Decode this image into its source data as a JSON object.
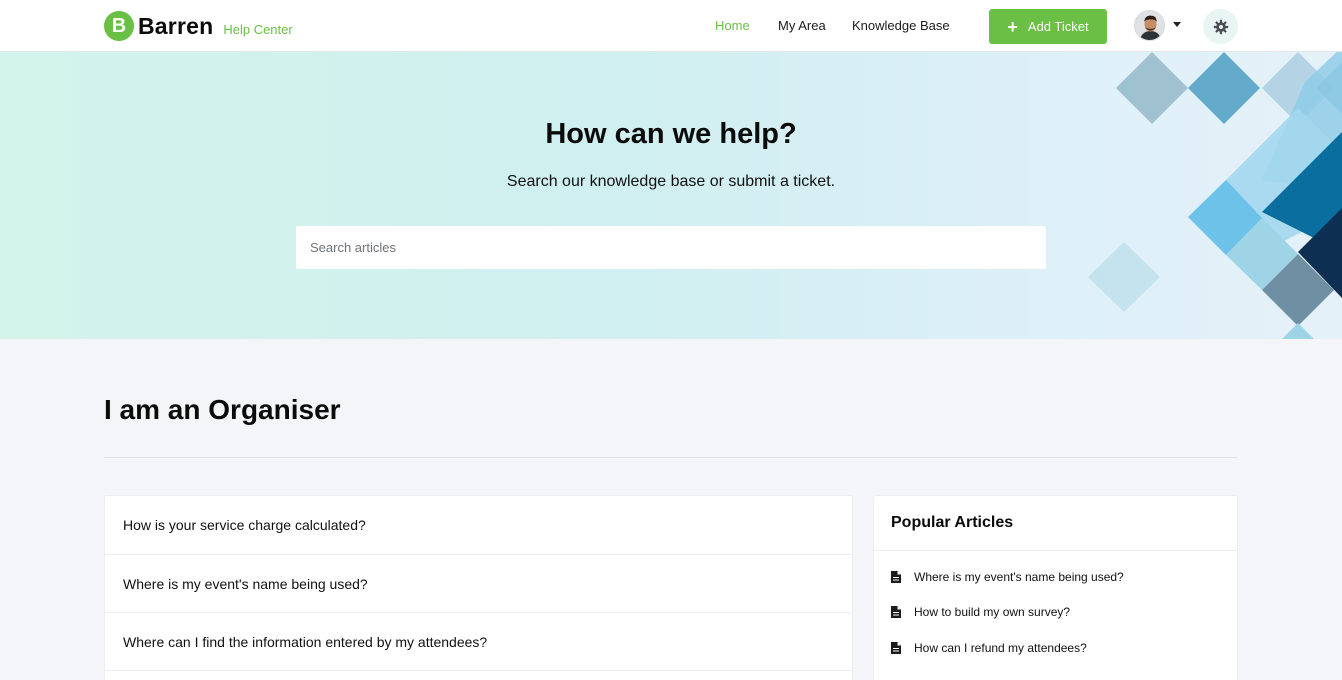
{
  "brand": {
    "letter": "B",
    "name": "Barren",
    "subtitle": "Help Center"
  },
  "nav": {
    "home": "Home",
    "my_area": "My Area",
    "knowledge_base": "Knowledge Base"
  },
  "header": {
    "add_ticket_label": "Add Ticket"
  },
  "hero": {
    "title": "How can we help?",
    "subtitle": "Search our knowledge base or submit a ticket.",
    "search_placeholder": "Search articles"
  },
  "section": {
    "title": "I am an Organiser"
  },
  "faq": {
    "items": [
      "How is your service charge calculated?",
      "Where is my event's name being used?",
      "Where can I find the information entered by my attendees?"
    ]
  },
  "popular": {
    "title": "Popular Articles",
    "items": [
      "Where is my event's name being used?",
      "How to build my own survey?",
      "How can I refund my attendees?"
    ]
  },
  "colors": {
    "accent": "#6ac045",
    "hero_bg": "#d3f4ea",
    "page_bg": "#f4f5f8"
  },
  "icons": {
    "add": "plus-icon",
    "settings": "gear-icon",
    "menu": "chevron-down-icon",
    "article": "document-icon"
  }
}
